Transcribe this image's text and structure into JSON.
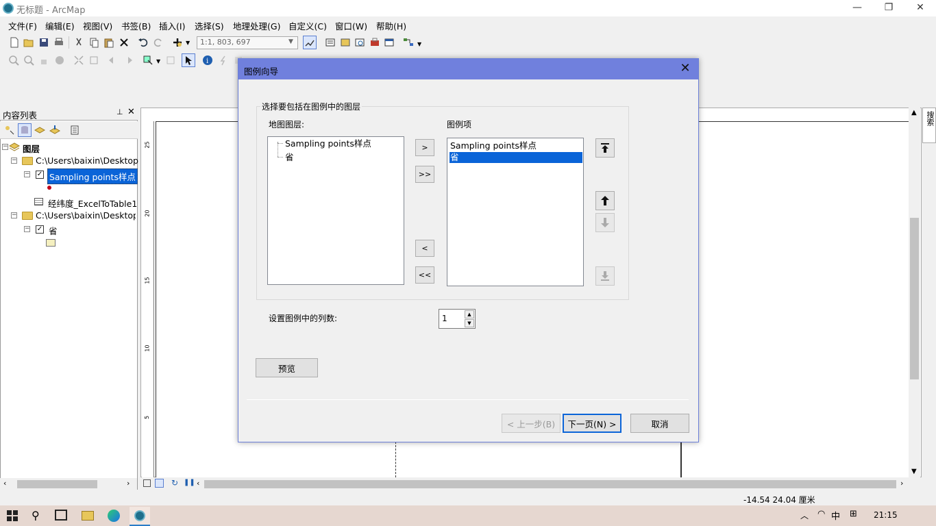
{
  "window": {
    "title": "无标题 - ArcMap"
  },
  "menu": [
    "文件(F)",
    "编辑(E)",
    "视图(V)",
    "书签(B)",
    "插入(I)",
    "选择(S)",
    "地理处理(G)",
    "自定义(C)",
    "窗口(W)",
    "帮助(H)"
  ],
  "toolbar": {
    "scale": "1:1, 803, 697"
  },
  "toc": {
    "title": "内容列表",
    "root": "图层",
    "items": [
      {
        "label": "C:\\Users\\baixin\\Desktop"
      },
      {
        "label": "Sampling points样点"
      },
      {
        "label": "经纬度_ExcelToTable1"
      },
      {
        "label": "C:\\Users\\baixin\\Desktop\\"
      },
      {
        "label": "省"
      }
    ]
  },
  "right_tab": "搜索",
  "status": {
    "coords": "-14.54  24.04 厘米"
  },
  "ruler": {
    "ticks": [
      "25",
      "20",
      "15",
      "10",
      "5"
    ]
  },
  "dialog": {
    "title": "图例向导",
    "group_label": "选择要包括在图例中的图层",
    "map_layers_label": "地图图层:",
    "legend_items_label": "图例项",
    "map_layers": [
      "Sampling points样点",
      "省"
    ],
    "legend_items": [
      "Sampling points样点",
      "省"
    ],
    "selected_legend_item": "省",
    "btn_add": ">",
    "btn_add_all": ">>",
    "btn_remove": "<",
    "btn_remove_all": "<<",
    "columns_label": "设置图例中的列数:",
    "columns_value": "1",
    "preview": "预览",
    "back": "< 上一步(B)",
    "next": "下一页(N) >",
    "cancel": "取消"
  },
  "taskbar": {
    "time": "21:15",
    "ime": "中"
  }
}
